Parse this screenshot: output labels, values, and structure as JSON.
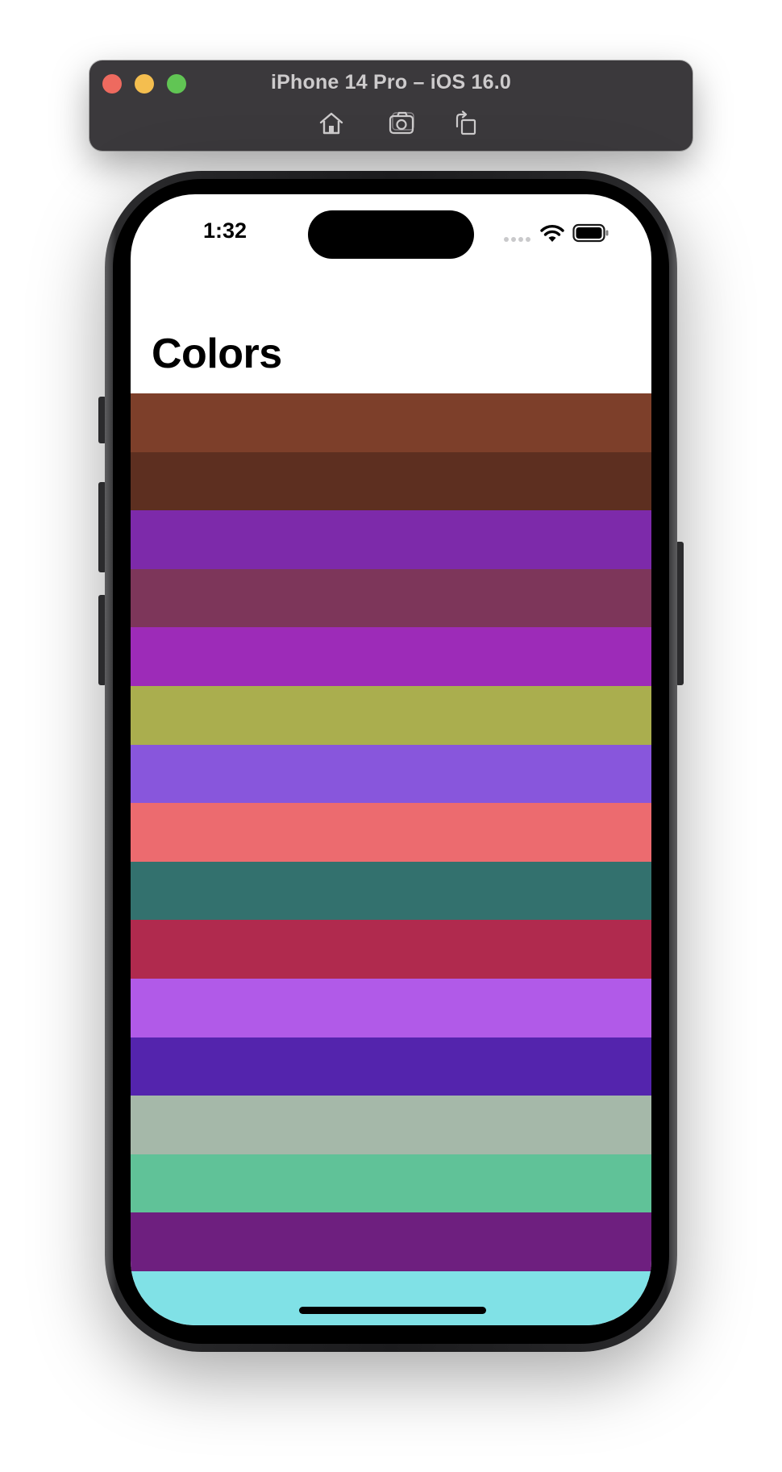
{
  "window": {
    "title": "iPhone 14 Pro – iOS 16.0",
    "toolbar": {
      "home_icon": "home-icon",
      "screenshot_icon": "camera-icon",
      "rotate_icon": "rotate-icon"
    }
  },
  "status_bar": {
    "time": "1:32",
    "wifi_icon": "wifi-icon",
    "battery_icon": "battery-icon"
  },
  "nav": {
    "title": "Colors"
  },
  "colors": [
    "#7d3f2a",
    "#5d2f20",
    "#7d2aaa",
    "#7d365a",
    "#9d2bb8",
    "#aaae4e",
    "#8856dc",
    "#ec6b6f",
    "#33716e",
    "#b02a4e",
    "#b15ae8",
    "#5424ad",
    "#a5b8a9",
    "#60c298",
    "#6e1f7f",
    "#80e1e6"
  ]
}
